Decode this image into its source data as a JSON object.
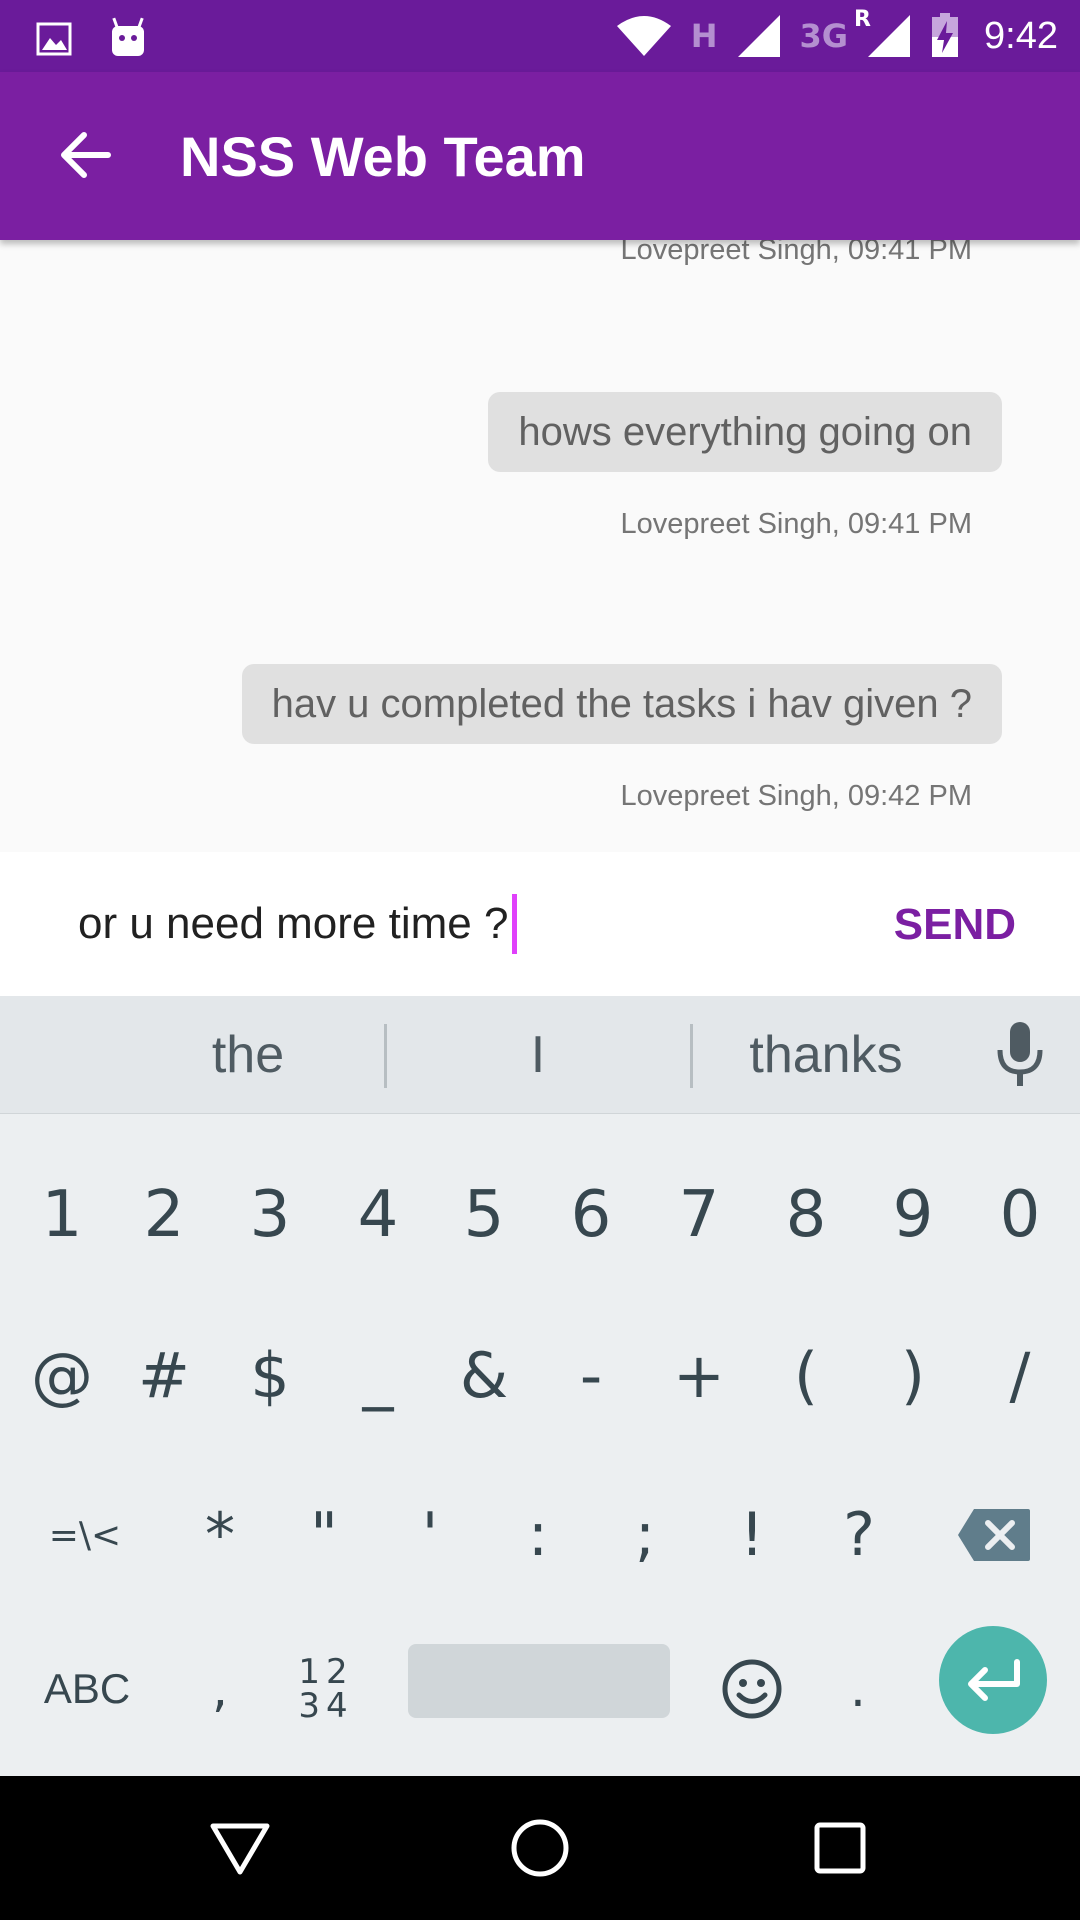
{
  "status_bar": {
    "icons": [
      "image-icon",
      "android-icon",
      "wifi-icon",
      "signal-icon",
      "signal-roaming-icon",
      "battery-charging-icon"
    ],
    "network_h": "H",
    "network_3g": "3G",
    "roaming": "R",
    "time": "9:42"
  },
  "app_bar": {
    "title": "NSS Web Team",
    "back_icon": "arrow-back-icon",
    "color": "#7b1fa2"
  },
  "messages": [
    {
      "text": "",
      "meta": "Lovepreet Singh, 09:41 PM"
    },
    {
      "text": "hows everything going on",
      "meta": "Lovepreet Singh, 09:41 PM"
    },
    {
      "text": "hav u completed the tasks i hav given ?",
      "meta": "Lovepreet Singh, 09:42 PM"
    }
  ],
  "composer": {
    "value": "or u need more time ?",
    "send_label": "SEND"
  },
  "suggestions": [
    "the",
    "I",
    "thanks"
  ],
  "keyboard": {
    "row1": [
      "1",
      "2",
      "3",
      "4",
      "5",
      "6",
      "7",
      "8",
      "9",
      "0"
    ],
    "row2": [
      "@",
      "#",
      "$",
      "_",
      "&",
      "-",
      "+",
      "(",
      ")",
      "/"
    ],
    "row3": [
      "=\\<",
      "*",
      "\"",
      "'",
      ":",
      ";",
      "!",
      "?"
    ],
    "row4": {
      "abc": "ABC",
      "comma": ",",
      "numpad_top": "12",
      "numpad_bottom": "34",
      "period": "."
    },
    "accent": "#4db6ac"
  },
  "nav_bar": {
    "icons": [
      "back-triangle-icon",
      "home-circle-icon",
      "recents-square-icon"
    ]
  }
}
